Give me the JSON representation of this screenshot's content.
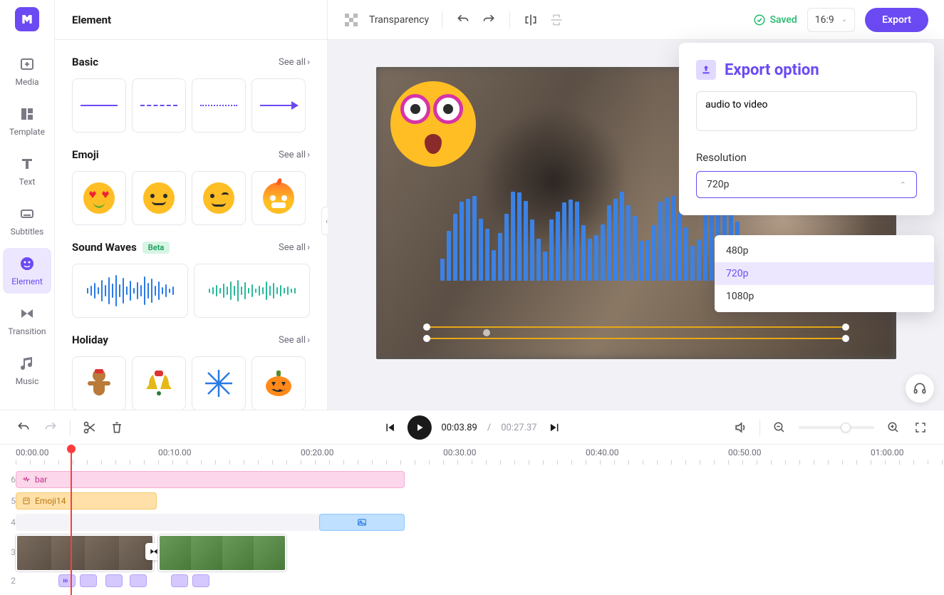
{
  "nav": {
    "items": [
      {
        "id": "media",
        "label": "Media"
      },
      {
        "id": "template",
        "label": "Template"
      },
      {
        "id": "text",
        "label": "Text"
      },
      {
        "id": "subtitles",
        "label": "Subtitles"
      },
      {
        "id": "element",
        "label": "Element"
      },
      {
        "id": "transition",
        "label": "Transition"
      },
      {
        "id": "music",
        "label": "Music"
      }
    ],
    "active": "element"
  },
  "side_panel": {
    "title": "Element",
    "see_all": "See all",
    "sections": {
      "basic": {
        "title": "Basic"
      },
      "emoji": {
        "title": "Emoji"
      },
      "sound": {
        "title": "Sound Waves",
        "tag": "Beta"
      },
      "holiday": {
        "title": "Holiday"
      }
    }
  },
  "top_bar": {
    "transparency": "Transparency",
    "saved": "Saved",
    "ratio": "16:9",
    "export": "Export"
  },
  "export_popover": {
    "title": "Export option",
    "name": "audio to video",
    "resolution_label": "Resolution",
    "resolution_value": "720p",
    "options": [
      "480p",
      "720p",
      "1080p"
    ],
    "selected": "720p"
  },
  "timeline": {
    "current": "00:03.89",
    "sep": "/",
    "duration": "00:27.37",
    "ruler": [
      "00:00.00",
      "00:10.00",
      "00:20.00",
      "00:30.00",
      "00:40.00",
      "00:50.00",
      "01:00.00"
    ],
    "tracks": {
      "6": {
        "label": "bar"
      },
      "5": {
        "label": "Emoji14"
      },
      "4": {
        "label": ""
      },
      "3": {
        "label": ""
      },
      "2": {
        "label": ""
      }
    }
  }
}
